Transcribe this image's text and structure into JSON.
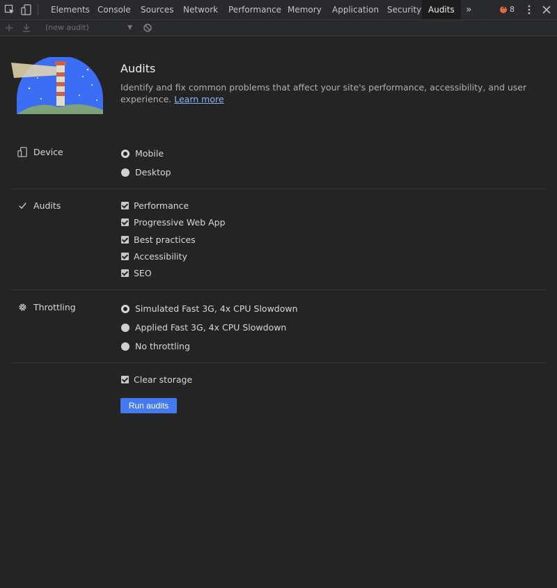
{
  "tabs": [
    "Elements",
    "Console",
    "Sources",
    "Network",
    "Performance",
    "Memory",
    "Application",
    "Security",
    "Audits"
  ],
  "active_tab": "Audits",
  "more_tabs": "»",
  "error_count": "8",
  "toolbar": {
    "audit_select": "(new audit)"
  },
  "hero": {
    "title": "Audits",
    "description": "Identify and fix common problems that affect your site's performance, accessibility, and user experience.",
    "link": "Learn more"
  },
  "device": {
    "label": "Device",
    "options": [
      {
        "label": "Mobile",
        "checked": true
      },
      {
        "label": "Desktop",
        "checked": false
      }
    ]
  },
  "audits": {
    "label": "Audits",
    "options": [
      {
        "label": "Performance",
        "checked": true
      },
      {
        "label": "Progressive Web App",
        "checked": true
      },
      {
        "label": "Best practices",
        "checked": true
      },
      {
        "label": "Accessibility",
        "checked": true
      },
      {
        "label": "SEO",
        "checked": true
      }
    ]
  },
  "throttling": {
    "label": "Throttling",
    "options": [
      {
        "label": "Simulated Fast 3G, 4x CPU Slowdown",
        "checked": true
      },
      {
        "label": "Applied Fast 3G, 4x CPU Slowdown",
        "checked": false
      },
      {
        "label": "No throttling",
        "checked": false
      }
    ]
  },
  "clear_storage": {
    "label": "Clear storage",
    "checked": true
  },
  "run_button": "Run audits",
  "colors": {
    "accent": "#4479f0",
    "link": "#8ab4f8",
    "background": "#242424"
  }
}
